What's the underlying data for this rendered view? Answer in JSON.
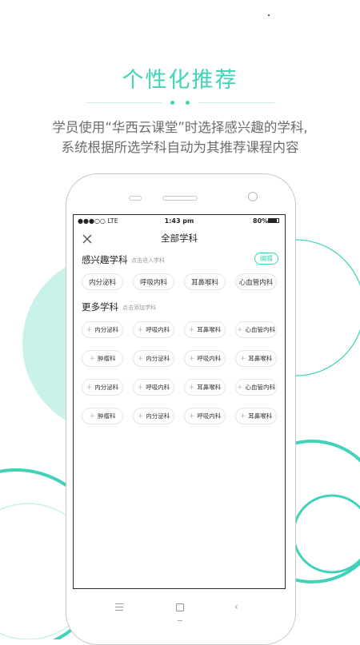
{
  "headline": "个性化推荐",
  "subtitle_line1": "学员使用“华西云课堂”时选择感兴趣的学科,",
  "subtitle_line2": "系统根据所选学科自动为其推荐课程内容",
  "status_bar": {
    "carrier": "●●●○○ LTE",
    "time": "1:43 pm",
    "battery": "80%"
  },
  "nav": {
    "title": "全部学科",
    "close_icon": "close-icon"
  },
  "interest_section": {
    "title": "感兴趣学科",
    "hint": "点击进入学科",
    "edit_label": "编辑",
    "chips": [
      "内分泌科",
      "呼吸内科",
      "耳鼻喉科",
      "心血管内科"
    ]
  },
  "more_section": {
    "title": "更多学科",
    "hint": "点击添加学科",
    "rows": [
      [
        "内分泌科",
        "呼吸内科",
        "耳鼻喉科",
        "心血管内科"
      ],
      [
        "肿瘤科",
        "内分泌科",
        "呼吸内科",
        "耳鼻喉科"
      ],
      [
        "内分泌科",
        "呼吸内科",
        "耳鼻喉科",
        "心血管内科"
      ],
      [
        "肿瘤科",
        "内分泌科",
        "呼吸内科",
        "耳鼻喉科"
      ]
    ]
  },
  "colors": {
    "accent": "#41d3b8",
    "accent_light": "#c9f3ea",
    "subtitle": "#6c6c6c"
  },
  "phone_buttons": {
    "menu_icon": "menu-icon",
    "home_icon": "home-icon",
    "back_icon": "back-icon"
  }
}
